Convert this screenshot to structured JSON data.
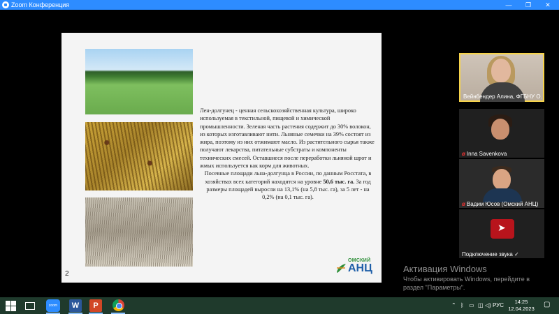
{
  "window": {
    "title": "Zoom Конференция",
    "minimize_glyph": "—",
    "maximize_glyph": "❐",
    "close_glyph": "✕"
  },
  "slide": {
    "paragraph1": "Лен-долгунец - ценная сельскохозяйственная культура, широко используемая в текстильной, пищевой и химической промышленности. Зеленая часть растения содержит до 30% волокон, из которых изготавливают нити. Льняные семечки на 39% состоят из жира, поэтому из них отжимают масло. Из растительного сырья также получают лекарства, питательные субстраты и компоненты технических смесей. Оставшиеся после переработки льняной шрот и жмых используется как корм для животных.",
    "paragraph2_before": "Посевные площади льна-долгунца в России, по данным Росстата, в хозяйствах всех категорий находятся на уровне ",
    "paragraph2_bold": "50,6 тыс. га.",
    "paragraph2_after": " За год размеры площадей выросли на 13,1% (на 5,8 тыс. га), за 5 лет - на 0,2% (на 0,1 тыс. га).",
    "page_number": "2",
    "logo_top": "ОМСКИЙ",
    "logo_main": "АНЦ"
  },
  "participants": [
    {
      "name": "Вейнбендер Алина, ФГБНУ О...",
      "muted": false
    },
    {
      "name": "Inna Savenkova",
      "muted": true
    },
    {
      "name": "Вадим Юсов (Омский АНЦ)",
      "muted": true
    },
    {
      "name": "Подключение звука ✓",
      "muted": false
    }
  ],
  "watermark": {
    "line1": "Активация Windows",
    "line2": "Чтобы активировать Windows, перейдите в раздел \"Параметры\"."
  },
  "taskbar": {
    "zoom_label": "zoom",
    "word_label": "W",
    "ppt_label": "P",
    "language": "РУС",
    "time": "14:25",
    "date": "12.04.2023"
  },
  "colors": {
    "zoom_blue": "#2d8cff",
    "taskbar": "#1f3a2c",
    "active_speaker": "#f6d34a"
  }
}
